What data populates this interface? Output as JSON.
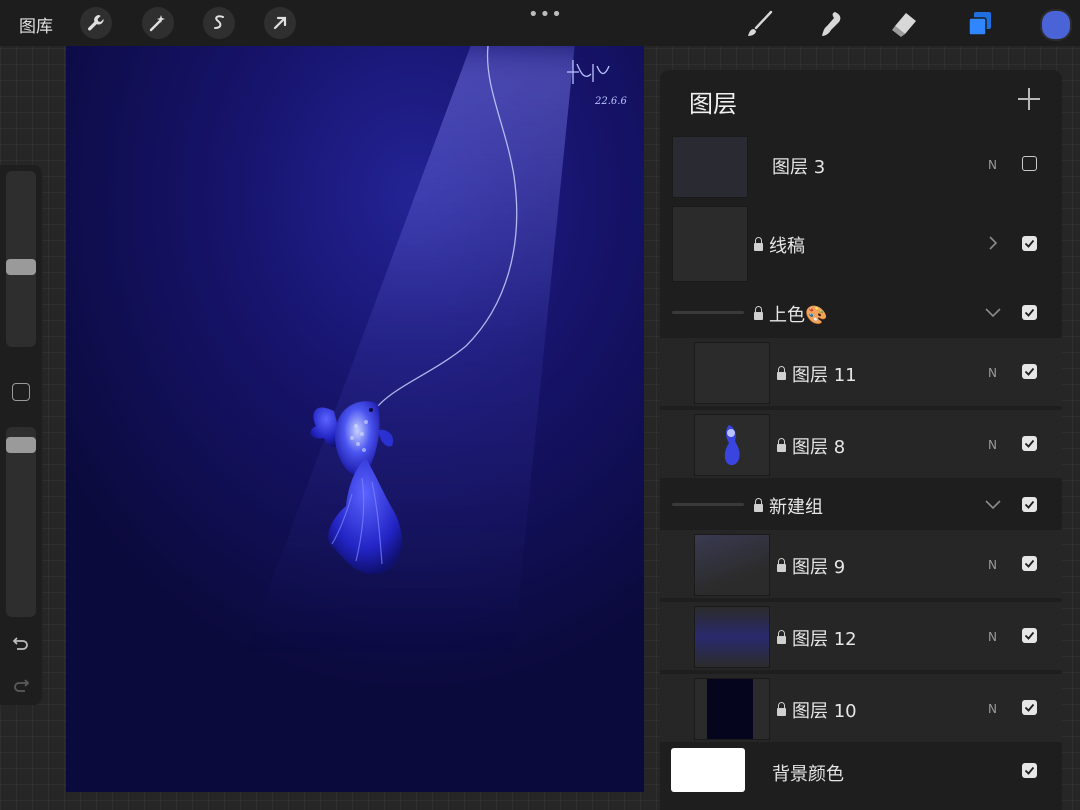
{
  "toolbar": {
    "gallery_label": "图库",
    "more_label": "•••",
    "tools": [
      "wrench-icon",
      "magic-wand-icon",
      "selection-icon",
      "transform-arrow-icon"
    ],
    "right_tools": [
      "brush-icon",
      "smudge-icon",
      "eraser-icon",
      "layers-icon"
    ],
    "current_color": "#4a63d6"
  },
  "canvas": {
    "signature_name": "小喻",
    "signature_date": "22.6.6"
  },
  "layers_panel": {
    "title": "图层",
    "layers": [
      {
        "name": "图层 3",
        "blend": "N",
        "visible": false,
        "locked": false
      },
      {
        "name": "线稿",
        "type": "group-collapsed",
        "visible": true,
        "locked": true
      },
      {
        "name": "上色🎨",
        "type": "group-expanded",
        "visible": true,
        "locked": true
      },
      {
        "name": "图层 11",
        "blend": "N",
        "visible": true,
        "locked": true
      },
      {
        "name": "图层 8",
        "blend": "N",
        "visible": true,
        "locked": true
      },
      {
        "name": "新建组",
        "type": "group-expanded",
        "visible": true,
        "locked": true
      },
      {
        "name": "图层 9",
        "blend": "N",
        "visible": true,
        "locked": true
      },
      {
        "name": "图层 12",
        "blend": "N",
        "visible": true,
        "locked": true
      },
      {
        "name": "图层 10",
        "blend": "N",
        "visible": true,
        "locked": true
      },
      {
        "name": "背景颜色",
        "visible": true,
        "locked": false
      }
    ]
  }
}
